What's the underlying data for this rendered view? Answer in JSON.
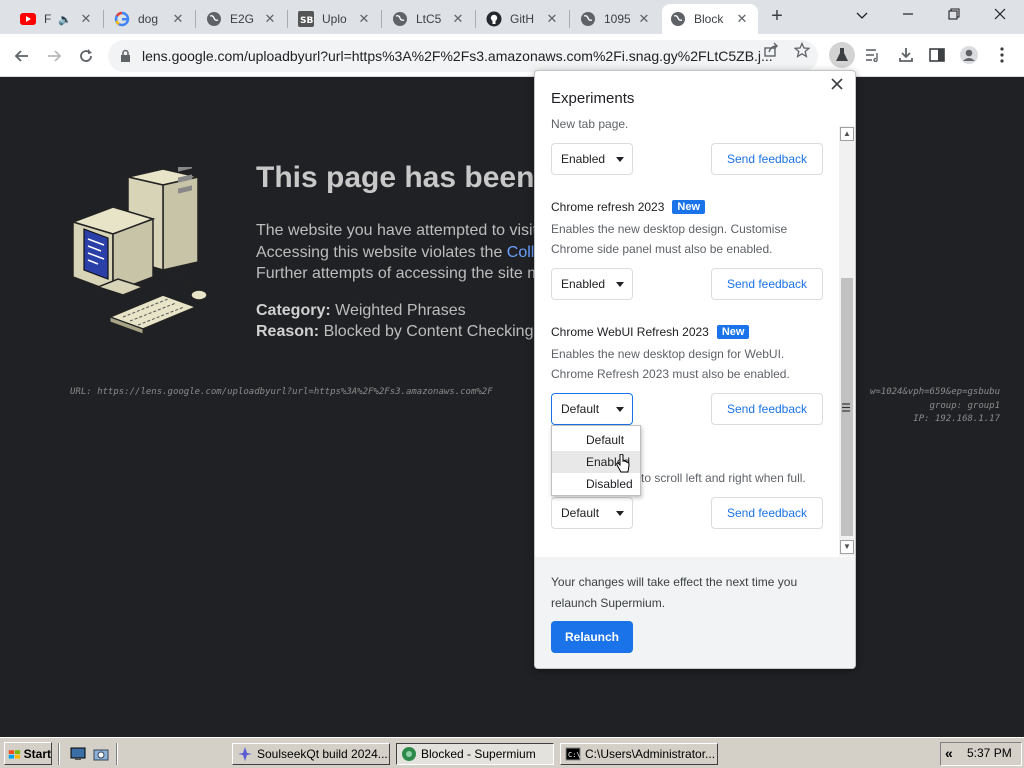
{
  "tabs": [
    {
      "title": "F",
      "icon": "youtube-icon",
      "audio": true
    },
    {
      "title": "dog",
      "icon": "google-icon"
    },
    {
      "title": "E2G",
      "icon": "globe-icon"
    },
    {
      "title": "Uplo",
      "icon": "sb-icon"
    },
    {
      "title": "LtC5",
      "icon": "globe-icon"
    },
    {
      "title": "GitH",
      "icon": "github-icon"
    },
    {
      "title": "1095",
      "icon": "globe-icon"
    },
    {
      "title": "Block",
      "icon": "globe-icon",
      "active": true
    }
  ],
  "toolbar": {
    "url": "lens.google.com/uploadbyurl?url=https%3A%2F%2Fs3.amazonaws.com%2Fi.snag.gy%2FLtC5ZB.j..."
  },
  "blocked_page": {
    "headline": "This page has been",
    "line1": "The website you have attempted to visit",
    "line2_prefix": "Accessing this website violates the ",
    "line2_link": "Colla",
    "line3": "Further attempts of accessing the site m",
    "category_label": "Category:",
    "category_value": "Weighted Phrases",
    "reason_label": "Reason:",
    "reason_value": "Blocked by Content Checking.",
    "url_line": "URL: https://lens.google.com/uploadbyurl?url=https%3A%2F%2Fs3.amazonaws.com%2F",
    "right_line1": "w=1024&vph=659&ep=gsbubu",
    "right_line2": "group: group1",
    "right_line3": "IP: 192.168.1.17"
  },
  "experiments": {
    "title": "Experiments",
    "partial_desc": "New tab page.",
    "first_select": "Enabled",
    "feedback_label": "Send feedback",
    "items": [
      {
        "name": "Chrome refresh 2023",
        "badge": "New",
        "desc1": "Enables the new desktop design. Customise",
        "desc2": "Chrome side panel must also be enabled.",
        "value": "Enabled"
      },
      {
        "name": "Chrome WebUI Refresh 2023",
        "badge": "New",
        "desc1": "Enables the new desktop design for WebUI.",
        "desc2": "Chrome Refresh 2023 must also be enabled.",
        "value": "Default"
      },
      {
        "desc_partial": "to scroll left and right when full.",
        "value": "Default"
      }
    ],
    "dropdown_options": [
      "Default",
      "Enabled",
      "Disabled"
    ],
    "footer_note1": "Your changes will take effect the next time you",
    "footer_note2": "relaunch Supermium.",
    "relaunch_label": "Relaunch"
  },
  "taskbar": {
    "start_label": "Start",
    "items": [
      {
        "label": "SoulseekQt build 2024....",
        "icon": "soulseek-icon"
      },
      {
        "label": "Blocked - Supermium",
        "icon": "supermium-icon",
        "active": true
      },
      {
        "label": "C:\\Users\\Administrator...",
        "icon": "cmd-icon"
      }
    ],
    "clock": "5:37 PM"
  }
}
